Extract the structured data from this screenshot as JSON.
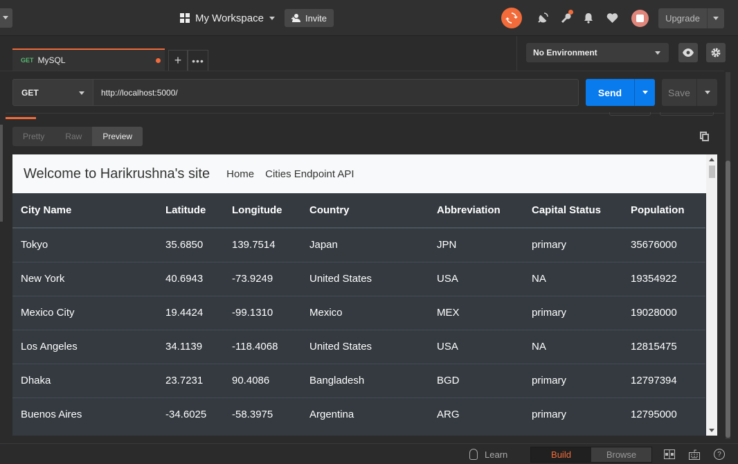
{
  "header": {
    "workspace_label": "My Workspace",
    "invite_label": "Invite",
    "upgrade_label": "Upgrade"
  },
  "tabs": [
    {
      "method": "GET",
      "name": "MySQL",
      "unsaved": true
    }
  ],
  "environment": {
    "selected": "No Environment"
  },
  "request": {
    "method": "GET",
    "url": "http://localhost:5000/",
    "send_label": "Send",
    "save_label": "Save"
  },
  "response": {
    "view_tabs": [
      "Pretty",
      "Raw",
      "Preview"
    ],
    "active_view": "Preview"
  },
  "preview": {
    "brand": "Welcome to Harikrushna's site",
    "nav_links": [
      "Home",
      "Cities Endpoint API"
    ],
    "columns": [
      "City Name",
      "Latitude",
      "Longitude",
      "Country",
      "Abbreviation",
      "Capital Status",
      "Population"
    ],
    "rows": [
      [
        "Tokyo",
        "35.6850",
        "139.7514",
        "Japan",
        "JPN",
        "primary",
        "35676000"
      ],
      [
        "New York",
        "40.6943",
        "-73.9249",
        "United States",
        "USA",
        "NA",
        "19354922"
      ],
      [
        "Mexico City",
        "19.4424",
        "-99.1310",
        "Mexico",
        "MEX",
        "primary",
        "19028000"
      ],
      [
        "Los Angeles",
        "34.1139",
        "-118.4068",
        "United States",
        "USA",
        "NA",
        "12815475"
      ],
      [
        "Dhaka",
        "23.7231",
        "90.4086",
        "Bangladesh",
        "BGD",
        "primary",
        "12797394"
      ],
      [
        "Buenos Aires",
        "-34.6025",
        "-58.3975",
        "Argentina",
        "ARG",
        "primary",
        "12795000"
      ]
    ]
  },
  "statusbar": {
    "learn_label": "Learn",
    "modes": [
      "Build",
      "Browse"
    ],
    "active_mode": "Build"
  },
  "colors": {
    "accent": "#f26b3a",
    "send": "#097bed",
    "method_get": "#56b870"
  }
}
